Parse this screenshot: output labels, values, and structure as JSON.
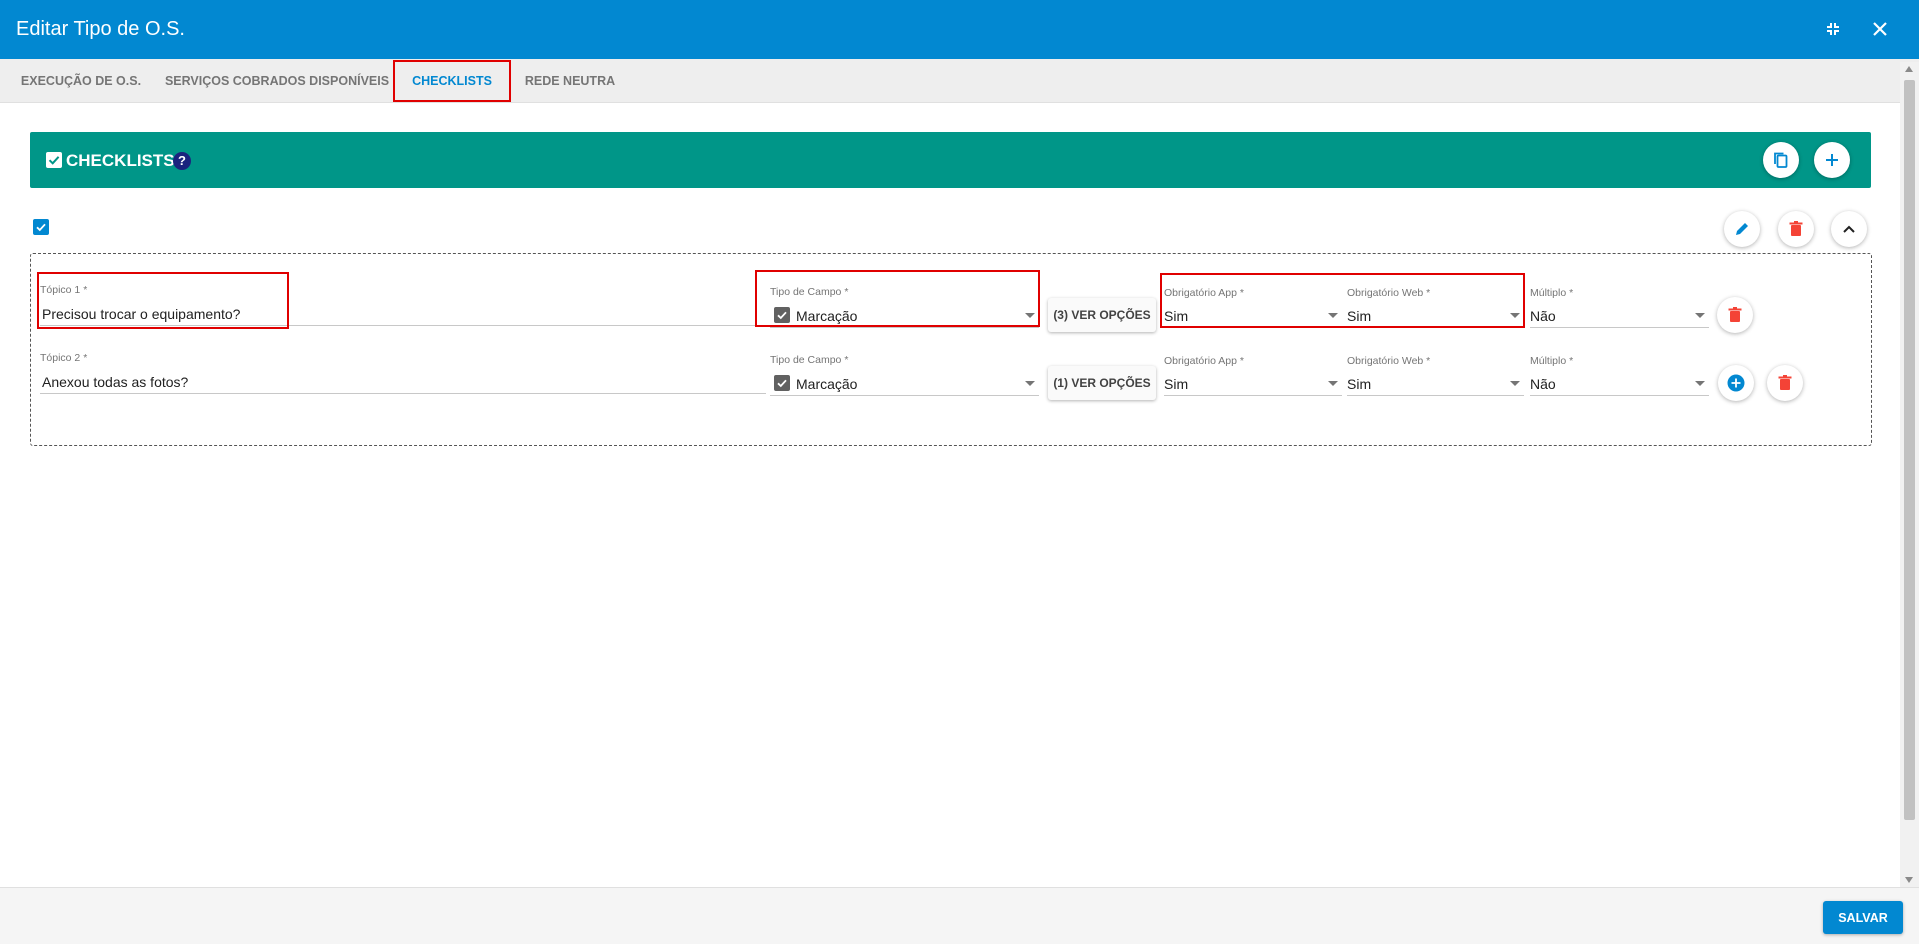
{
  "window": {
    "title": "Editar Tipo de O.S.",
    "minimize_icon": "compress-icon",
    "close_icon": "close-icon"
  },
  "tabs": [
    {
      "label": "EXECUÇÃO DE O.S.",
      "active": false
    },
    {
      "label": "SERVIÇOS COBRADOS DISPONÍVEIS",
      "active": false
    },
    {
      "label": "CHECKLISTS",
      "active": true
    },
    {
      "label": "REDE NEUTRA",
      "active": false
    }
  ],
  "section": {
    "title": "CHECKLISTS",
    "help": "?",
    "color": "#009688"
  },
  "topics": [
    {
      "topic_label": "Tópico 1 *",
      "topic_value": "Precisou trocar o equipamento?",
      "tipo_label": "Tipo de Campo *",
      "tipo_value": "Marcação",
      "options_button": "(3) VER OPÇÕES",
      "app_label": "Obrigatório App *",
      "app_value": "Sim",
      "web_label": "Obrigatório Web *",
      "web_value": "Sim",
      "multiplo_label": "Múltiplo *",
      "multiplo_value": "Não"
    },
    {
      "topic_label": "Tópico 2 *",
      "topic_value": "Anexou todas as fotos?",
      "tipo_label": "Tipo de Campo *",
      "tipo_value": "Marcação",
      "options_button": "(1) VER OPÇÕES",
      "app_label": "Obrigatório App *",
      "app_value": "Sim",
      "web_label": "Obrigatório Web *",
      "web_value": "Sim",
      "multiplo_label": "Múltiplo *",
      "multiplo_value": "Não"
    }
  ],
  "footer": {
    "save_label": "SALVAR"
  },
  "colors": {
    "primary": "#0288d1",
    "teal": "#009688",
    "danger": "#f44336",
    "highlight": "#e00000"
  }
}
